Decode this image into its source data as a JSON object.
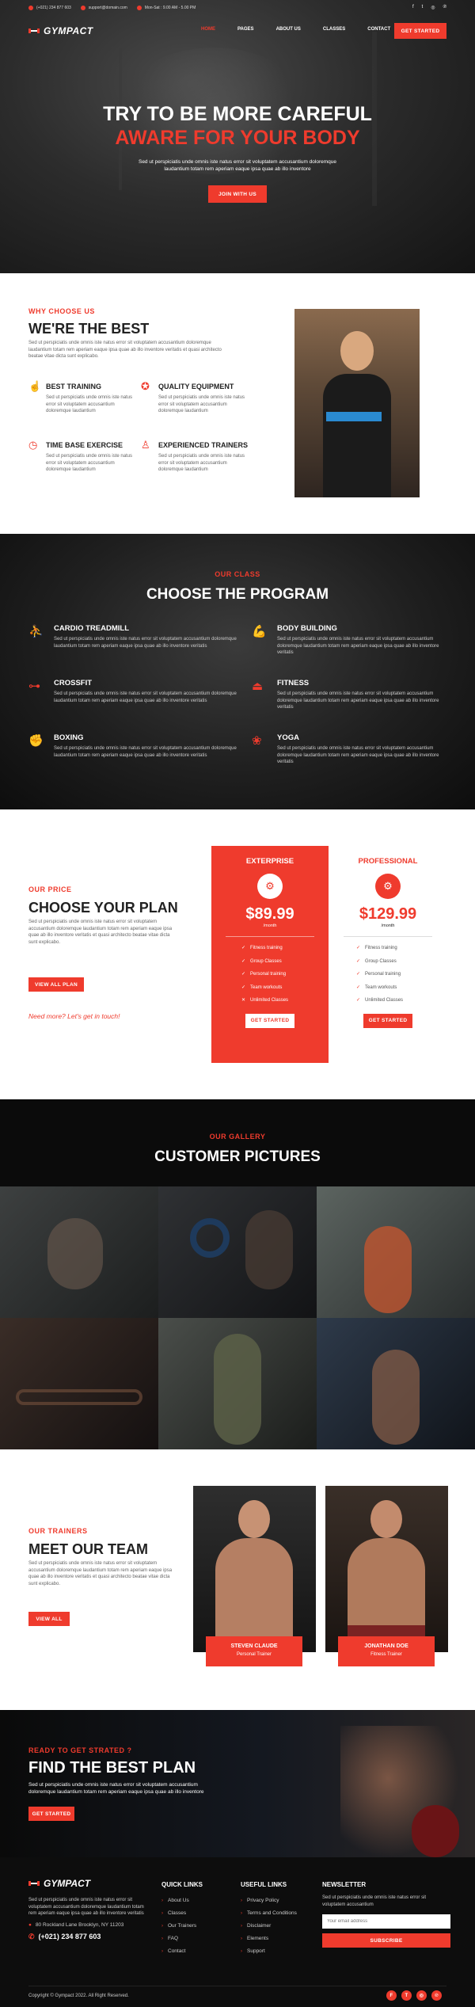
{
  "topbar": {
    "phone": "(+021) 234 877 603",
    "email": "support@domain.com",
    "hours": "Mon-Sat : 9.00 AM - 5.00 PM",
    "social": [
      "f",
      "t",
      "◎",
      "℗"
    ]
  },
  "nav": {
    "logo": "GYMPACT",
    "items": [
      "HOME",
      "PAGES",
      "ABOUT US",
      "CLASSES",
      "CONTACT"
    ],
    "cta": "GET STARTED"
  },
  "hero": {
    "title_line1": "TRY TO BE MORE CAREFUL",
    "title_line2": "AWARE FOR YOUR BODY",
    "text": "Sed ut perspiciatis unde omnis iste natus error sit voluptatem accusantium doloremque laudantium totam rem aperiam eaque ipsa quae ab illo inventore",
    "button": "JOIN WITH US"
  },
  "why": {
    "eyebrow": "WHY CHOOSE US",
    "title": "WE'RE THE BEST",
    "text": "Sed ut perspiciatis unde omnis iste natus error sit voluptatem accusantium doloremque laudantium totam rem aperiam eaque ipsa quae ab illo inventore veritatis et quasi architecto beatae vitae dicta sunt explicabo.",
    "features": [
      {
        "title": "BEST TRAINING",
        "text": "Sed ut perspiciatis unde omnis iste natus error sit voluptatem accusantium doloremque laudantium"
      },
      {
        "title": "QUALITY EQUIPMENT",
        "text": "Sed ut perspiciatis unde omnis iste natus error sit voluptatem accusantium doloremque laudantium"
      },
      {
        "title": "TIME BASE EXERCISE",
        "text": "Sed ut perspiciatis unde omnis iste natus error sit voluptatem accusantium doloremque laudantium"
      },
      {
        "title": "EXPERIENCED TRAINERS",
        "text": "Sed ut perspiciatis unde omnis iste natus error sit voluptatem accusantium doloremque laudantium"
      }
    ]
  },
  "program": {
    "eyebrow": "OUR CLASS",
    "title": "CHOOSE THE PROGRAM",
    "items": [
      {
        "title": "CARDIO TREADMILL",
        "icon": "treadmill-icon",
        "text": "Sed ut perspiciatis unde omnis iste natus error sit voluptatem accusantium doloremque laudantium totam rem aperiam eaque ipsa quae ab illo inventore veritatis"
      },
      {
        "title": "BODY BUILDING",
        "icon": "arm-muscle-icon",
        "text": "Sed ut perspiciatis unde omnis iste natus error sit voluptatem accusantium doloremque laudantium totam rem aperiam eaque ipsa quae ab illo inventore veritatis"
      },
      {
        "title": "CROSSFIT",
        "icon": "dumbbell-icon",
        "text": "Sed ut perspiciatis unde omnis iste natus error sit voluptatem accusantium doloremque laudantium totam rem aperiam eaque ipsa quae ab illo inventore veritatis"
      },
      {
        "title": "FITNESS",
        "icon": "kettlebell-icon",
        "text": "Sed ut perspiciatis unde omnis iste natus error sit voluptatem accusantium doloremque laudantium totam rem aperiam eaque ipsa quae ab illo inventore veritatis"
      },
      {
        "title": "BOXING",
        "icon": "boxing-glove-icon",
        "text": "Sed ut perspiciatis unde omnis iste natus error sit voluptatem accusantium doloremque laudantium totam rem aperiam eaque ipsa quae ab illo inventore veritatis"
      },
      {
        "title": "YOGA",
        "icon": "lotus-icon",
        "text": "Sed ut perspiciatis unde omnis iste natus error sit voluptatem accusantium doloremque laudantium totam rem aperiam eaque ipsa quae ab illo inventore veritatis"
      }
    ]
  },
  "pricing": {
    "eyebrow": "OUR PRICE",
    "title": "CHOOSE YOUR PLAN",
    "text": "Sed ut perspiciatis unde omnis iste natus error sit voluptatem accusantium doloremque laudantium totam rem aperiam eaque ipsa quae ab illo inventore veritatis et quasi architecto beatae vitae dicta sunt explicabo.",
    "button": "VIEW ALL PLAN",
    "help": "Need more? Let's get in touch!",
    "plans": [
      {
        "name": "EXTERPRISE",
        "price": "$89.99",
        "per": "/month",
        "features": [
          "Fitness training",
          "Group Classes",
          "Personal training",
          "Team workouts",
          "Unlimited Classes"
        ],
        "button": "GET STARTED"
      },
      {
        "name": "PROFESSIONAL",
        "price": "$129.99",
        "per": "/month",
        "features": [
          "Fitness training",
          "Group Classes",
          "Personal training",
          "Team workouts",
          "Unlimited Classes"
        ],
        "button": "GET STARTED"
      }
    ]
  },
  "gallery": {
    "eyebrow": "OUR GALLERY",
    "title": "CUSTOMER PICTURES"
  },
  "team": {
    "eyebrow": "OUR TRAINERS",
    "title": "MEET OUR TEAM",
    "text": "Sed ut perspiciatis unde omnis iste natus error sit voluptatem accusantium doloremque laudantium totam rem aperiam eaque ipsa quae ab illo inventore veritatis et quasi architecto beatae vitae dicta sunt explicabo.",
    "button": "VIEW ALL",
    "members": [
      {
        "name": "STEVEN CLAUDE",
        "role": "Personal Trainer"
      },
      {
        "name": "JONATHAN DOE",
        "role": "Fitness Trainer"
      }
    ]
  },
  "cta": {
    "eyebrow": "READY TO GET STRATED ?",
    "title": "FIND THE BEST PLAN",
    "text": "Sed ut perspiciatis unde omnis iste natus error sit voluptatem accusantium doloremque laudantium totam rem aperiam eaque ipsa quae ab illo inventore",
    "button": "GET STARTED"
  },
  "footer": {
    "logo": "GYMPACT",
    "text": "Sed ut perspiciatis unde omnis iste natus error sit voluptatem accusantium doloremque laudantium totam rem aperiam eaque ipsa quae ab illo inventore veritatis",
    "address": "80 Rockland Lane Brooklyn, NY 11203",
    "phone": "(+021) 234 877 603",
    "quick_title": "QUICK LINKS",
    "quick_links": [
      "About Us",
      "Classes",
      "Our Trainers",
      "FAQ",
      "Contact"
    ],
    "useful_title": "USEFUL LINKS",
    "useful_links": [
      "Privacy Policy",
      "Terms and Conditions",
      "Disclaimer",
      "Elements",
      "Support"
    ],
    "newsletter_title": "NEWSLETTER",
    "newsletter_text": "Sed ut perspiciatis unde omnis iste natus error sit voluptatem accusantium",
    "email_placeholder": "Your email address",
    "subscribe": "SUBSCRIBE",
    "copyright": "Copyright © Gympact 2022. All Right Reserved.",
    "social": [
      "f",
      "t",
      "◎",
      "℗"
    ]
  },
  "colors": {
    "accent": "#ef3b2d",
    "dark": "#0d0d0d"
  }
}
